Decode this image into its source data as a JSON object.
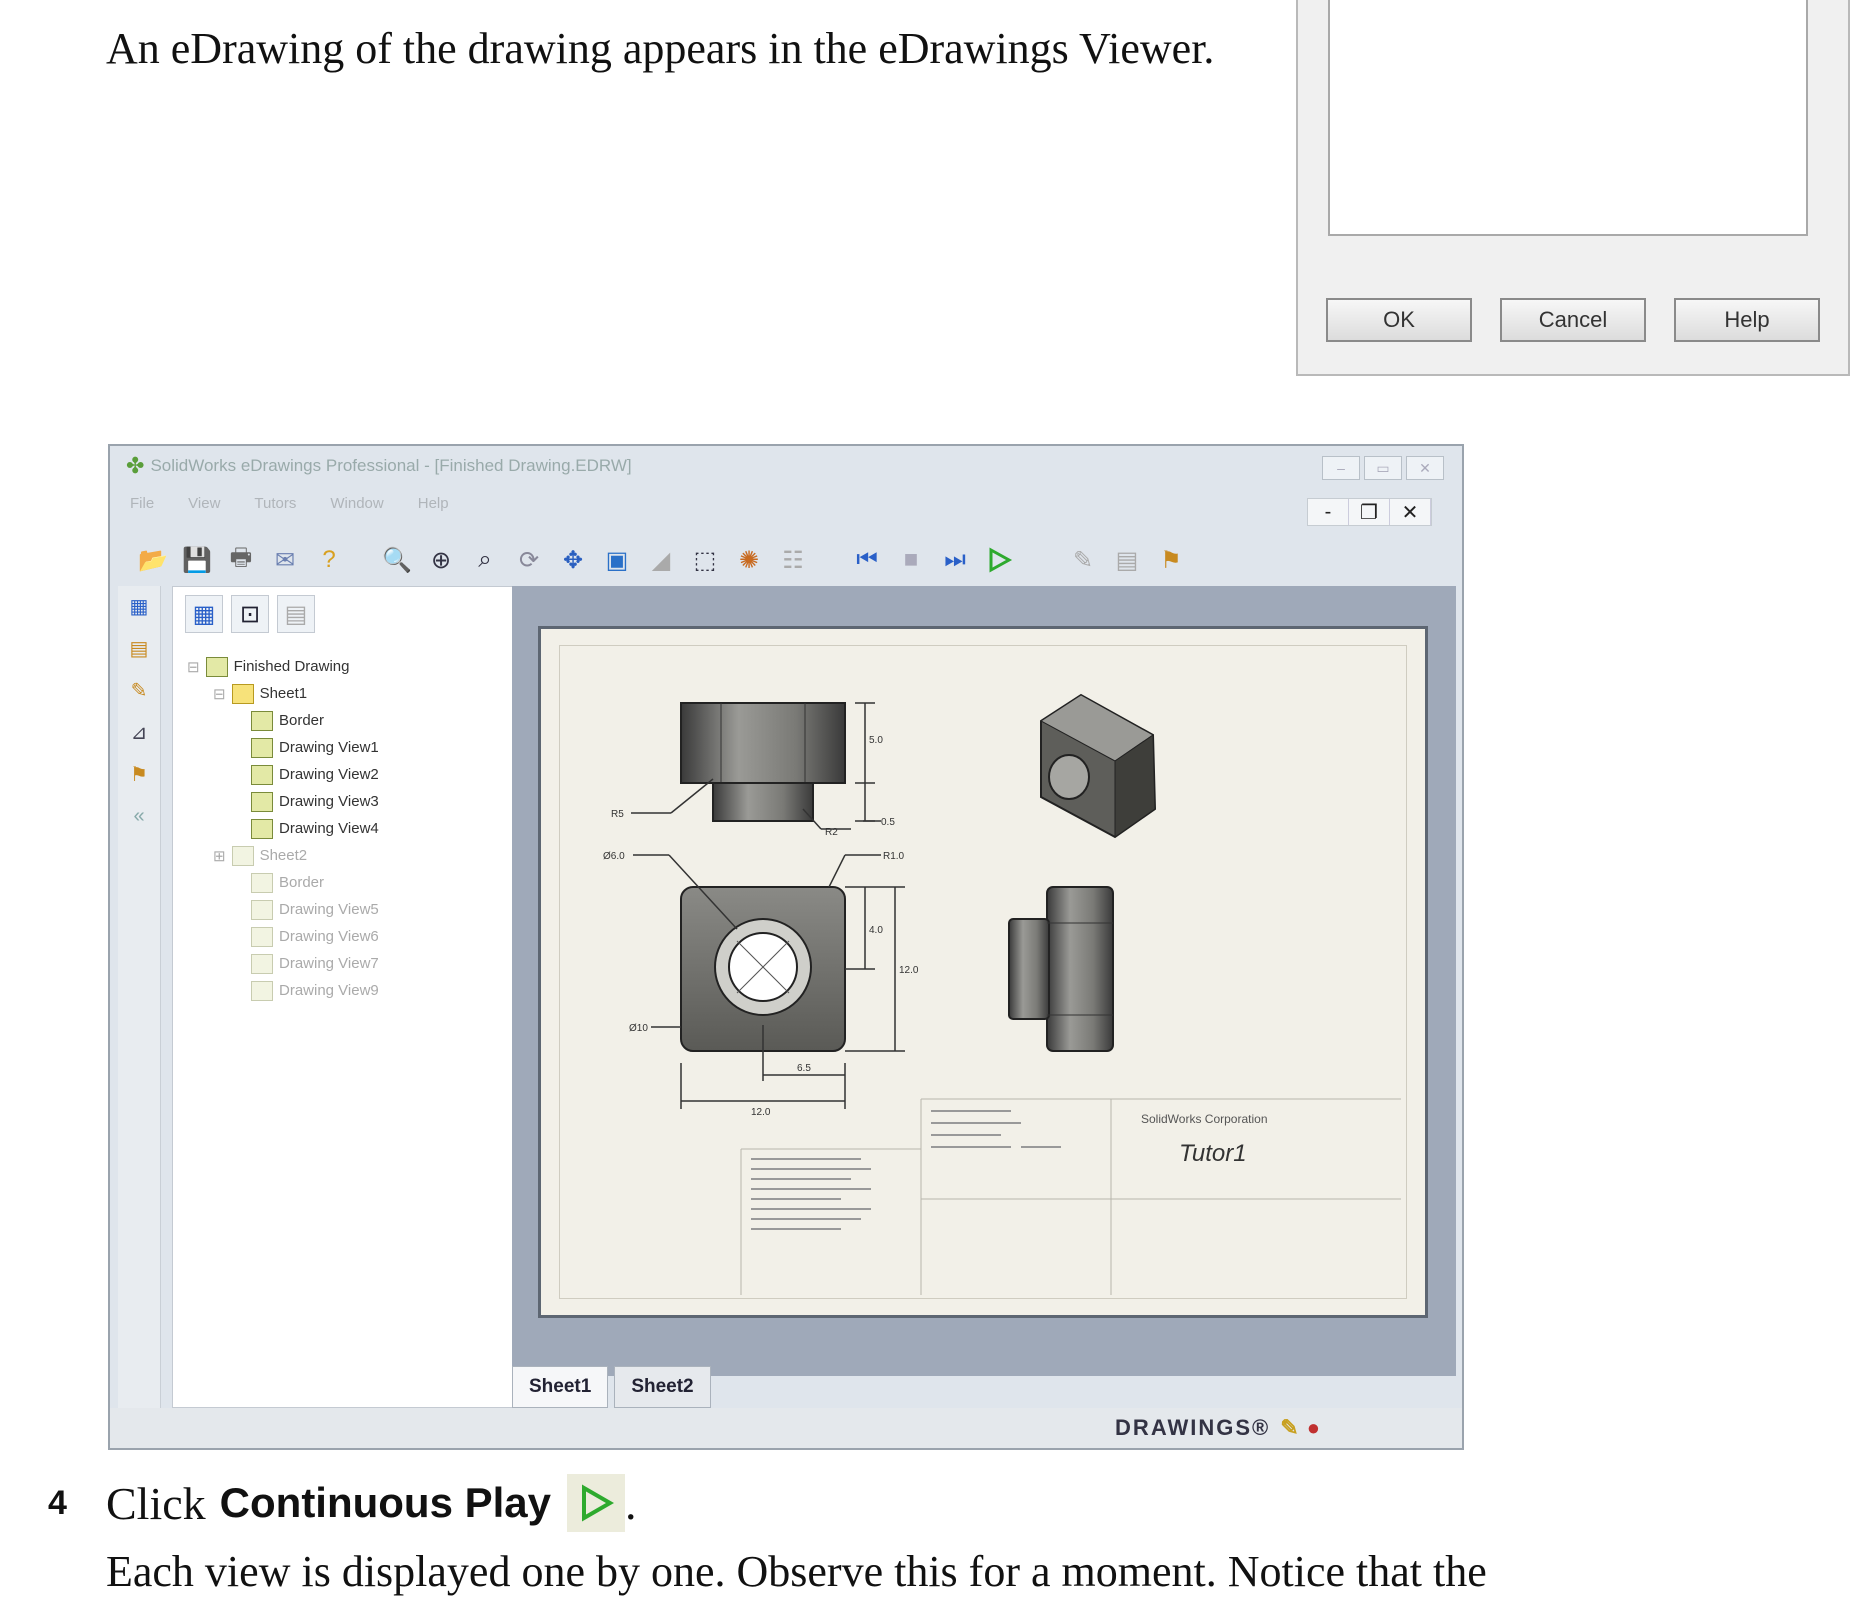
{
  "intro": "An eDrawing of the drawing appears in the eDrawings Viewer.",
  "dialog": {
    "ok": "OK",
    "cancel": "Cancel",
    "help": "Help"
  },
  "window": {
    "title": "SolidWorks eDrawings Professional - [Finished Drawing.EDRW]",
    "menu": [
      "File",
      "View",
      "Tutors",
      "Window",
      "Help"
    ],
    "tree": {
      "root": "Finished Drawing",
      "sheet1": "Sheet1",
      "sheet1_items": [
        "Border",
        "Drawing View1",
        "Drawing View2",
        "Drawing View3",
        "Drawing View4"
      ],
      "sheet2": "Sheet2",
      "sheet2_items": [
        "Border",
        "Drawing View5",
        "Drawing View6",
        "Drawing View7",
        "Drawing View9"
      ]
    },
    "drawing": {
      "dims": [
        "R5",
        "R2",
        "5.0",
        "0.5",
        "Ø6.0",
        "R1.0",
        "4.0",
        "12.0",
        "Ø10",
        "6.5",
        "12.0"
      ],
      "company": "SolidWorks Corporation",
      "title_block": "Tutor1"
    },
    "tabs": [
      "Sheet1",
      "Sheet2"
    ],
    "status_logo": "DRAWINGS®"
  },
  "step": {
    "number": "4",
    "prefix": "Click",
    "label": "Continuous Play",
    "suffix": "."
  },
  "footer": "Each view is displayed one by one. Observe this for a moment. Notice that the",
  "colors": {
    "play_green": "#2eaa2e",
    "sheet_bg": "#f2f0e8",
    "canvas_bg": "#9fa9b9"
  }
}
